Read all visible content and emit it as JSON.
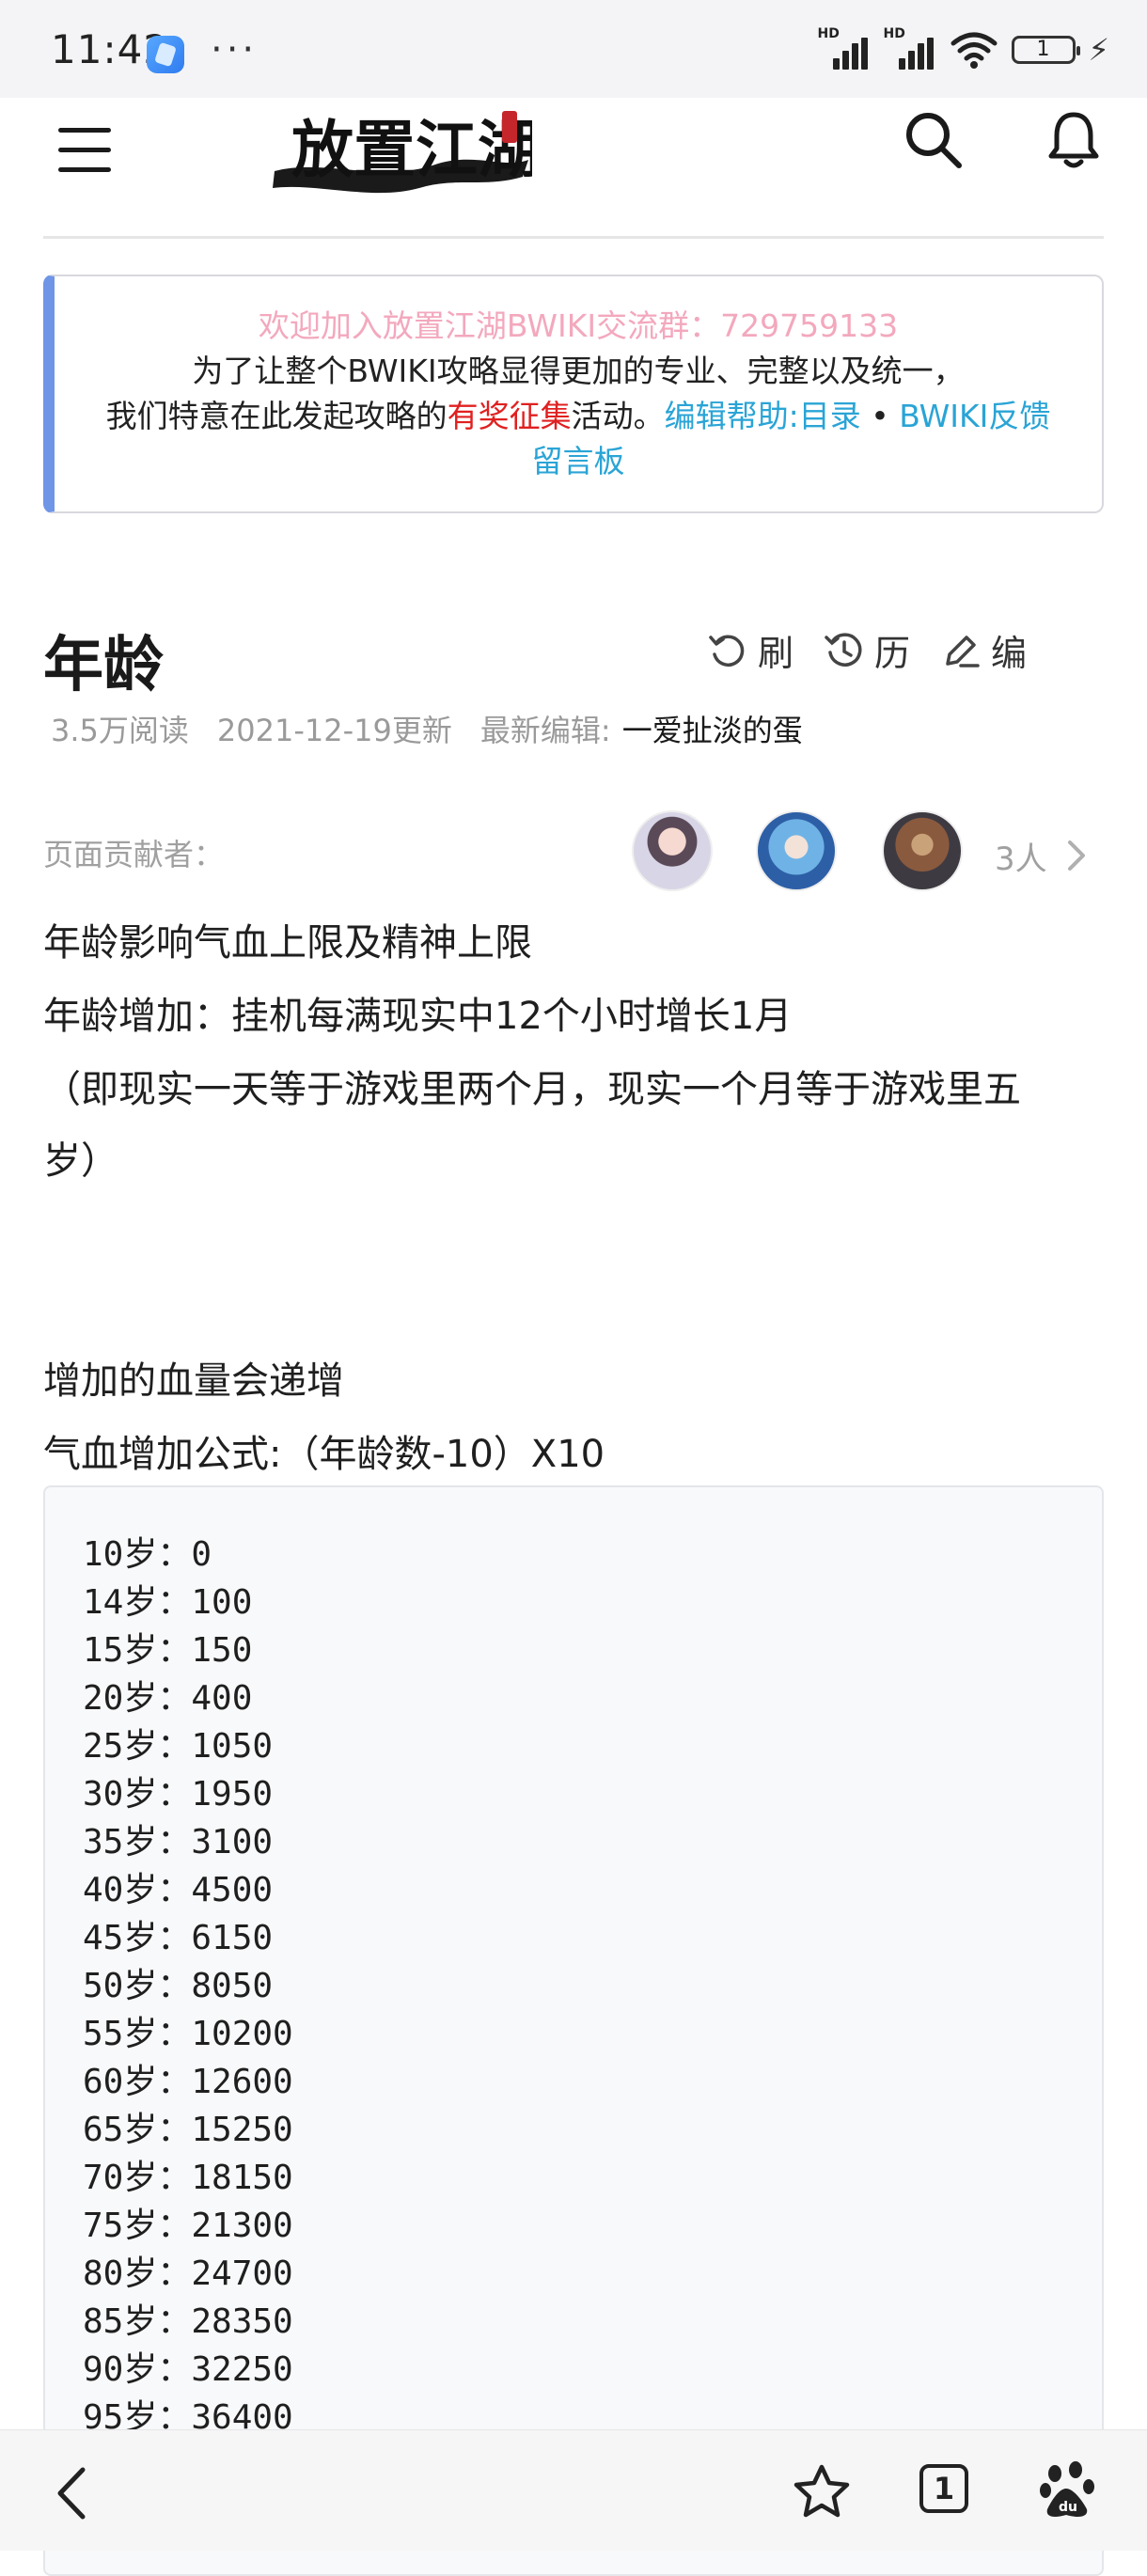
{
  "status_bar": {
    "time": "11:42",
    "dots": "···",
    "network_1": "HD",
    "network_2": "HD",
    "battery": "1"
  },
  "header": {
    "logo_alt": "放置江湖",
    "logo_text": "放置江湖"
  },
  "notice": {
    "line1": "欢迎加入放置江湖BWIKI交流群：729759133",
    "line2": "为了让整个BWIKI攻略显得更加的专业、完整以及统一，",
    "line3_prefix": "我们特意在此发起攻略的",
    "line3_highlight": "有奖征集",
    "line3_mid": "活动。",
    "line3_link1": "编辑帮助:目录",
    "line3_sep": " • ",
    "line3_link2": "BWIKI反馈",
    "line4_link": "留言板"
  },
  "page": {
    "title": "年龄",
    "actions": {
      "refresh": "刷",
      "history": "历",
      "edit": "编"
    },
    "meta": {
      "views": "3.5万阅读",
      "updated": "2021-12-19更新",
      "editor_label": "最新编辑:",
      "editor_name": "一爱扯淡的蛋"
    },
    "contributors": {
      "label": "页面贡献者：",
      "count": "3人"
    }
  },
  "content": {
    "p1": "年龄影响气血上限及精神上限",
    "p2": "年龄增加：挂机每满现实中12个小时增长1月",
    "p3": "（即现实一天等于游戏里两个月，现实一个月等于游戏里五",
    "p4": "岁）",
    "p5": "增加的血量会递增",
    "p6": "气血增加公式:（年龄数-10）X10",
    "age_table": [
      "10岁：0",
      "14岁：100",
      "15岁：150",
      "20岁：400",
      "25岁：1050",
      "30岁：1950",
      "35岁：3100",
      "40岁：4500",
      "45岁：6150",
      "50岁：8050",
      "55岁：10200",
      "60岁：12600",
      "65岁：15250",
      "70岁：18150",
      "75岁：21300",
      "80岁：24700",
      "85岁：28350",
      "90岁：32250",
      "95岁：36400"
    ]
  },
  "bottom_nav": {
    "tab_count": "1"
  }
}
